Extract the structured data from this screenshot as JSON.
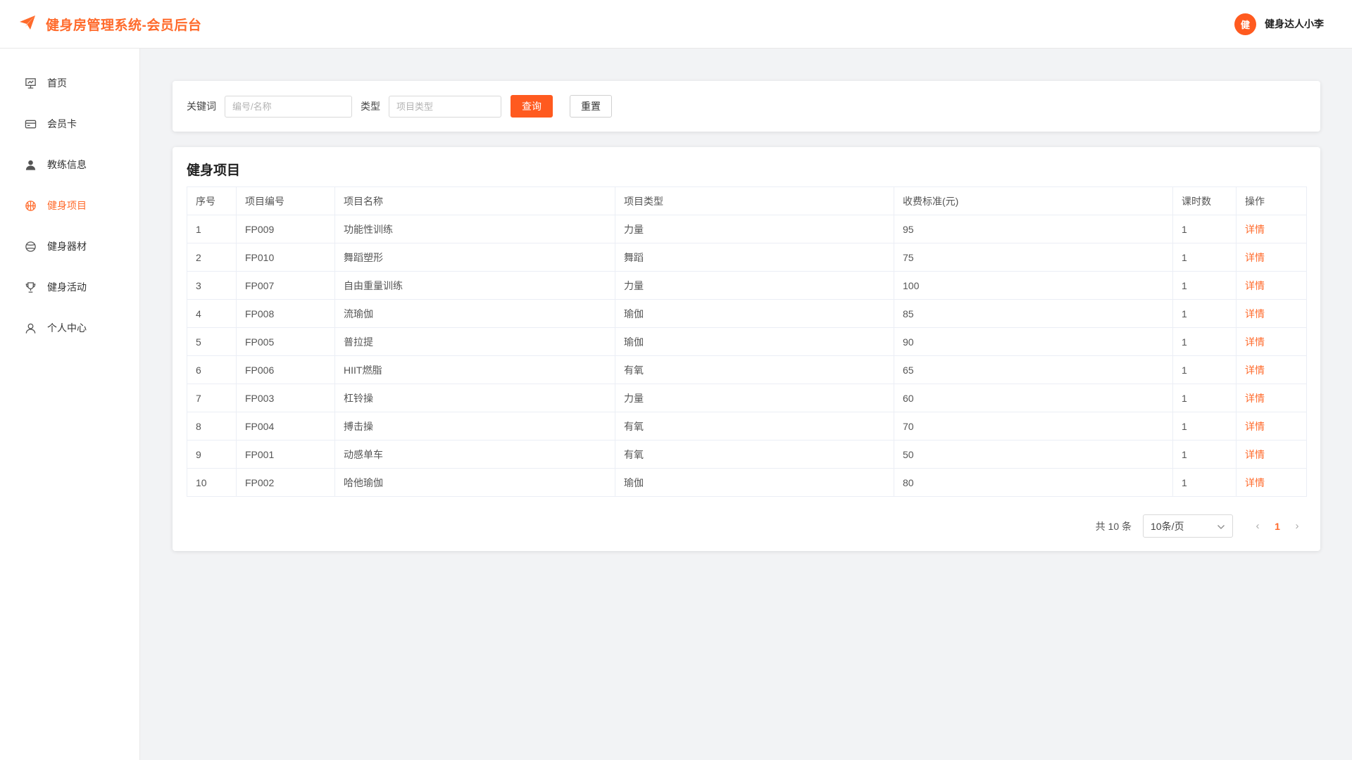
{
  "app": {
    "title": "健身房管理系统-会员后台"
  },
  "user": {
    "avatar_text": "健",
    "name": "健身达人小李"
  },
  "sidebar": {
    "items": [
      {
        "label": "首页",
        "icon": "dashboard-icon",
        "active": false
      },
      {
        "label": "会员卡",
        "icon": "card-icon",
        "active": false
      },
      {
        "label": "教练信息",
        "icon": "user-icon",
        "active": false
      },
      {
        "label": "健身项目",
        "icon": "basketball-icon",
        "active": true
      },
      {
        "label": "健身器材",
        "icon": "ball-icon",
        "active": false
      },
      {
        "label": "健身活动",
        "icon": "trophy-icon",
        "active": false
      },
      {
        "label": "个人中心",
        "icon": "person-outline-icon",
        "active": false
      }
    ]
  },
  "search": {
    "keyword_label": "关键词",
    "keyword_placeholder": "编号/名称",
    "type_label": "类型",
    "type_placeholder": "项目类型",
    "query_button": "查询",
    "reset_button": "重置"
  },
  "table": {
    "title": "健身项目",
    "columns": [
      "序号",
      "项目编号",
      "项目名称",
      "项目类型",
      "收费标准(元)",
      "课时数",
      "操作"
    ],
    "rows": [
      [
        "1",
        "FP009",
        "功能性训练",
        "力量",
        "95",
        "1",
        "详情"
      ],
      [
        "2",
        "FP010",
        "舞蹈塑形",
        "舞蹈",
        "75",
        "1",
        "详情"
      ],
      [
        "3",
        "FP007",
        "自由重量训练",
        "力量",
        "100",
        "1",
        "详情"
      ],
      [
        "4",
        "FP008",
        "流瑜伽",
        "瑜伽",
        "85",
        "1",
        "详情"
      ],
      [
        "5",
        "FP005",
        "普拉提",
        "瑜伽",
        "90",
        "1",
        "详情"
      ],
      [
        "6",
        "FP006",
        "HIIT燃脂",
        "有氧",
        "65",
        "1",
        "详情"
      ],
      [
        "7",
        "FP003",
        "杠铃操",
        "力量",
        "60",
        "1",
        "详情"
      ],
      [
        "8",
        "FP004",
        "搏击操",
        "有氧",
        "70",
        "1",
        "详情"
      ],
      [
        "9",
        "FP001",
        "动感单车",
        "有氧",
        "50",
        "1",
        "详情"
      ],
      [
        "10",
        "FP002",
        "哈他瑜伽",
        "瑜伽",
        "80",
        "1",
        "详情"
      ]
    ]
  },
  "pagination": {
    "total_text": "共 10 条",
    "page_size": "10条/页",
    "current_page": "1"
  },
  "colors": {
    "accent": "#ff6a2b",
    "background": "#f2f3f5"
  }
}
